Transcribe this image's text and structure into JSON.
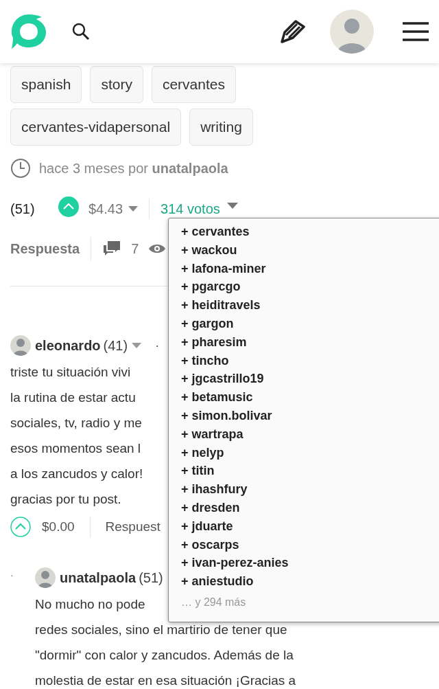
{
  "tags": [
    {
      "label": "spanish"
    },
    {
      "label": "story"
    },
    {
      "label": "cervantes"
    },
    {
      "label": "cervantes-vidapersonal"
    },
    {
      "label": "writing"
    }
  ],
  "post_meta": {
    "text": "hace 3 meses por **unatalpaola**"
  },
  "post_votes": {
    "reputation": "(51)",
    "upvoted": true,
    "payout": "$4.43",
    "votes": "314 votos"
  },
  "post_actions": {
    "reply": "Respuesta",
    "comments": "7"
  },
  "comments": [
    {
      "author": "eleonardo",
      "reputation": "(41)",
      "separator": "·",
      "lines": [
        "triste tu situación vivi",
        "la rutina de estar actu",
        "sociales, tv, radio y me",
        "esos momentos sean l",
        "a los zancudos y calor!",
        "gracias por tu post."
      ],
      "upvoted": false,
      "payout": "$0.00",
      "reply": "Respuest"
    },
    {
      "author": "unatalpaola",
      "reputation": "(51)",
      "bullet": "·",
      "lines": [
        "No mucho no pode",
        "redes sociales, sino el martirio de tener que",
        "\"dormir\" con calor y zancudos. Además de la",
        "molestia de estar en esa situación ¡Gracias a"
      ]
    }
  ],
  "voters_dropdown": {
    "voters": [
      "+ cervantes",
      "+ wackou",
      "+ lafona-miner",
      "+ pgarcgo",
      "+ heiditravels",
      "+ gargon",
      "+ pharesim",
      "+ tincho",
      "+ jgcastrillo19",
      "+ betamusic",
      "+ simon.bolivar",
      "+ wartrapa",
      "+ nelyp",
      "+ titin",
      "+ ihashfury",
      "+ dresden",
      "+ jduarte",
      "+ oscarps",
      "+ ivan-perez-anies",
      "+ aniestudio"
    ],
    "more": "… y 294 más"
  }
}
